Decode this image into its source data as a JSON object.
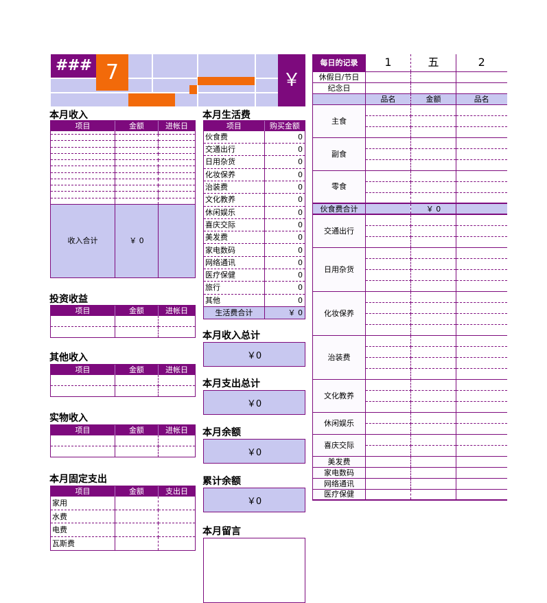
{
  "header": {
    "hash_cell": "###",
    "month_number": "7",
    "currency_symbol": "￥"
  },
  "income": {
    "title": "本月收入",
    "columns": [
      "项目",
      "金额",
      "进帐日"
    ],
    "rows": [
      [
        "",
        "",
        ""
      ],
      [
        "",
        "",
        ""
      ],
      [
        "",
        "",
        ""
      ],
      [
        "",
        "",
        ""
      ],
      [
        "",
        "",
        ""
      ],
      [
        "",
        "",
        ""
      ],
      [
        "",
        "",
        ""
      ],
      [
        "",
        "",
        ""
      ],
      [
        "",
        "",
        ""
      ],
      [
        "",
        "",
        ""
      ],
      [
        "",
        "",
        ""
      ],
      [
        "",
        "",
        ""
      ]
    ],
    "total_label": "收入合计",
    "total_value": "￥ 0"
  },
  "investment": {
    "title": "投资收益",
    "columns": [
      "项目",
      "金额",
      "进帐日"
    ],
    "rows": [
      [
        "",
        "",
        ""
      ],
      [
        "",
        "",
        ""
      ]
    ]
  },
  "other_income": {
    "title": "其他收入",
    "columns": [
      "项目",
      "金额",
      "进帐日"
    ],
    "rows": [
      [
        "",
        "",
        ""
      ],
      [
        "",
        "",
        ""
      ]
    ]
  },
  "goods_income": {
    "title": "实物收入",
    "columns": [
      "项目",
      "金额",
      "进帐日"
    ],
    "rows": [
      [
        "",
        "",
        ""
      ],
      [
        "",
        "",
        ""
      ]
    ]
  },
  "fixed_expense": {
    "title": "本月固定支出",
    "columns": [
      "项目",
      "金额",
      "支出日"
    ],
    "rows": [
      [
        "家用",
        "",
        ""
      ],
      [
        "水费",
        "",
        ""
      ],
      [
        "电费",
        "",
        ""
      ],
      [
        "瓦斯费",
        "",
        ""
      ]
    ]
  },
  "living_expense": {
    "title": "本月生活费",
    "columns": [
      "项目",
      "购买金额"
    ],
    "rows": [
      [
        "伙食费",
        "0"
      ],
      [
        "交通出行",
        "0"
      ],
      [
        "日用杂货",
        "0"
      ],
      [
        "化妆保养",
        "0"
      ],
      [
        "治装费",
        "0"
      ],
      [
        "文化教养",
        "0"
      ],
      [
        "休闲娱乐",
        "0"
      ],
      [
        "喜庆交际",
        "0"
      ],
      [
        "美发费",
        "0"
      ],
      [
        "家电数码",
        "0"
      ],
      [
        "网络通讯",
        "0"
      ],
      [
        "医疗保健",
        "0"
      ],
      [
        "旅行",
        "0"
      ],
      [
        "其他",
        "0"
      ]
    ],
    "total_label": "生活费合计",
    "total_value": "￥ 0"
  },
  "summaries": [
    {
      "label": "本月收入总计",
      "value": "￥0"
    },
    {
      "label": "本月支出总计",
      "value": "￥0"
    },
    {
      "label": "本月余额",
      "value": "￥0"
    },
    {
      "label": "累计余额",
      "value": "￥0"
    }
  ],
  "memo": {
    "label": "本月留言",
    "value": ""
  },
  "daily_record": {
    "title": "每日的记录",
    "day_columns": [
      "1",
      "五",
      "2"
    ],
    "row_holiday": "休假日/节日",
    "row_anniversary": "纪念日",
    "sub_headers": [
      "品名",
      "金额",
      "品名"
    ],
    "categories": [
      {
        "name": "主食",
        "rows": 3
      },
      {
        "name": "副食",
        "rows": 3
      },
      {
        "name": "零食",
        "rows": 3
      }
    ],
    "food_total_label": "伙食费合计",
    "food_total_value": "￥ 0",
    "categories2": [
      {
        "name": "交通出行",
        "rows": 3
      },
      {
        "name": "日用杂货",
        "rows": 4
      },
      {
        "name": "化妆保养",
        "rows": 4
      },
      {
        "name": "治装费",
        "rows": 4
      },
      {
        "name": "文化教养",
        "rows": 3
      },
      {
        "name": "休闲娱乐",
        "rows": 2
      },
      {
        "name": "喜庆交际",
        "rows": 2
      },
      {
        "name": "美发费",
        "rows": 1
      },
      {
        "name": "家电数码",
        "rows": 1
      },
      {
        "name": "网络通讯",
        "rows": 1
      },
      {
        "name": "医疗保健",
        "rows": 1
      }
    ]
  },
  "colors": {
    "purple": "#7D0A7D",
    "lavender": "#C8C8F0",
    "orange": "#F26A0A",
    "white": "#FFFFFF"
  }
}
